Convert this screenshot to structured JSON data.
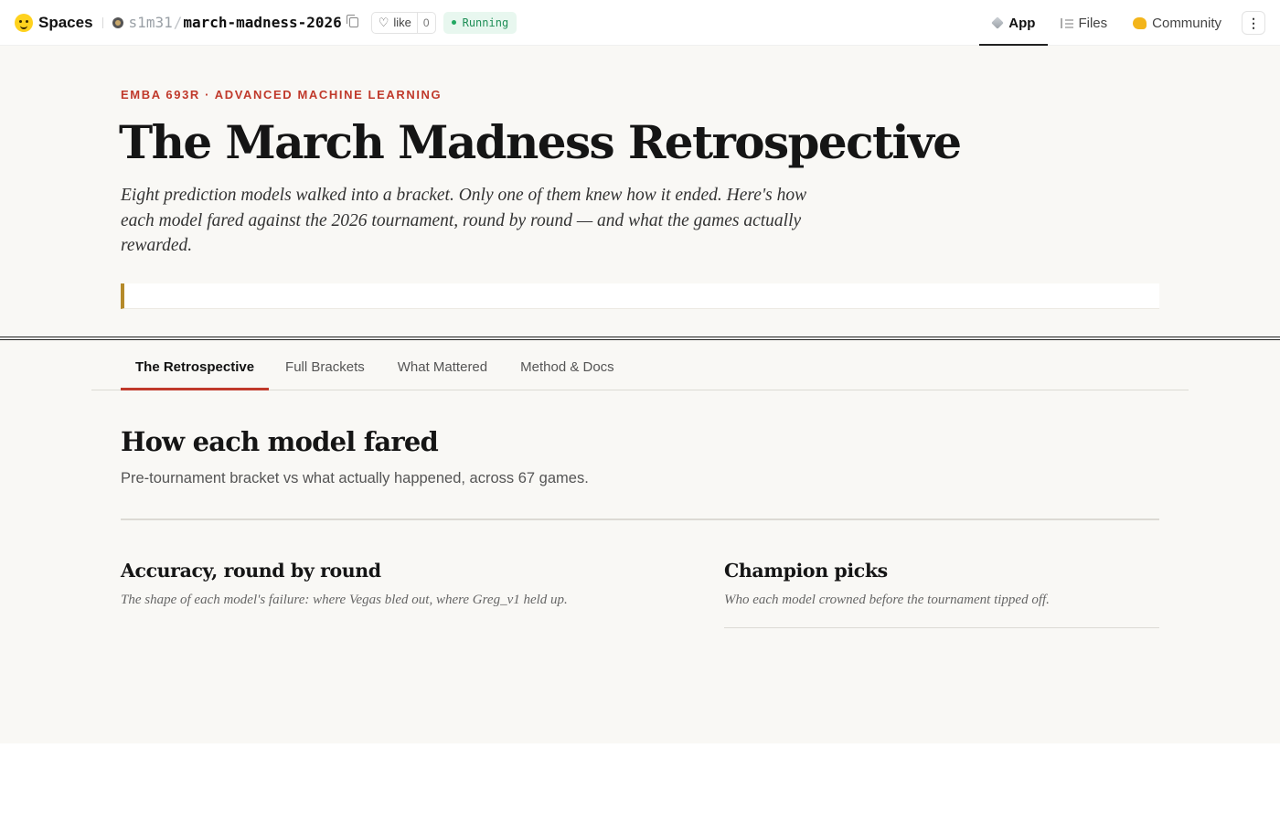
{
  "header": {
    "brand": "Spaces",
    "owner": "s1m31",
    "separator": "/",
    "repo": "march-madness-2026",
    "like_label": "like",
    "like_count": "0",
    "status": "Running"
  },
  "nav": {
    "app": "App",
    "files": "Files",
    "community": "Community",
    "more": "⋮"
  },
  "hero": {
    "eyebrow": "EMBA 693R · ADVANCED MACHINE LEARNING",
    "title": "The March Madness Retrospective",
    "lede": "Eight prediction models walked into a bracket. Only one of them knew how it ended. Here's how each model fared against the 2026 tournament, round by round — and what the games actually rewarded."
  },
  "tabs": [
    {
      "label": "The Retrospective",
      "active": true
    },
    {
      "label": "Full Brackets",
      "active": false
    },
    {
      "label": "What Mattered",
      "active": false
    },
    {
      "label": "Method & Docs",
      "active": false
    }
  ],
  "section": {
    "title": "How each model fared",
    "subtitle": "Pre-tournament bracket vs what actually happened, across 67 games."
  },
  "panels": {
    "accuracy": {
      "title": "Accuracy, round by round",
      "subtitle": "The shape of each model's failure: where Vegas bled out, where Greg_v1 held up."
    },
    "champions": {
      "title": "Champion picks",
      "subtitle": "Who each model crowned before the tournament tipped off."
    }
  },
  "colors": {
    "accent_red": "#c0392b",
    "callout_gold": "#b58a2a",
    "running_green": "#1e8e56",
    "page_bg": "#f9f8f5"
  }
}
